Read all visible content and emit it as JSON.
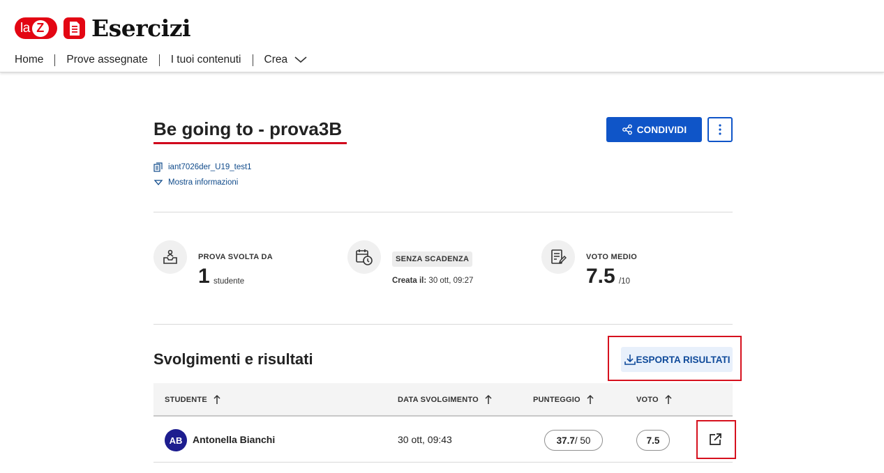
{
  "app": {
    "logo_la": "la",
    "logo_z": "Z",
    "title": "Esercizi"
  },
  "nav": {
    "items": [
      "Home",
      "Prove assegnate",
      "I tuoi contenuti",
      "Crea"
    ]
  },
  "page": {
    "title": "Be going to - prova3B",
    "share_label": "CONDIVIDI",
    "code": "iant7026der_U19_test1",
    "more_info": "Mostra informazioni"
  },
  "stats": {
    "done_label": "PROVA SVOLTA DA",
    "done_count": "1",
    "done_unit": "studente",
    "deadline_badge": "SENZA SCADENZA",
    "created_label": "Creata il:",
    "created_value": "30 ott, 09:27",
    "avg_label": "VOTO MEDIO",
    "avg_value": "7.5",
    "avg_max": "/10"
  },
  "results": {
    "title": "Svolgimenti e risultati",
    "export_label": "ESPORTA RISULTATI",
    "columns": [
      "STUDENTE",
      "DATA SVOLGIMENTO",
      "PUNTEGGIO",
      "VOTO"
    ],
    "rows": [
      {
        "initials": "AB",
        "name": "Antonella Bianchi",
        "date": "30 ott, 09:43",
        "score": "37.7",
        "score_max": "/ 50",
        "grade": "7.5"
      }
    ]
  },
  "colors": {
    "brand_red": "#e30613",
    "primary_blue": "#0f55c8",
    "avatar_blue": "#1d1d8f"
  }
}
